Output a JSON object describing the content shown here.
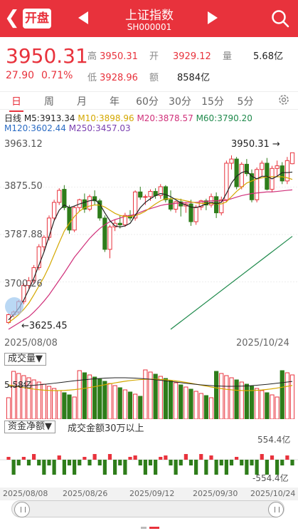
{
  "header": {
    "kaipan": "开盘",
    "title": "上证指数",
    "code": "SH000001"
  },
  "quote": {
    "price": "3950.31",
    "change": "27.90",
    "change_pct": "0.71%",
    "high_label": "高",
    "high": "3950.31",
    "open_label": "开",
    "open": "3929.12",
    "vol_label": "量",
    "vol": "5.68亿",
    "low_label": "低",
    "low": "3928.96",
    "amount_label": "额",
    "amount": "8584亿"
  },
  "tabs": [
    "日",
    "周",
    "月",
    "年",
    "60分",
    "30分",
    "15分",
    "5分"
  ],
  "ma": {
    "line1": [
      {
        "label": "日线 M5:3913.34",
        "color": "#222"
      },
      {
        "label": "M10:3898.96",
        "color": "#d4a800"
      },
      {
        "label": "M20:3878.57",
        "color": "#d0307a"
      },
      {
        "label": "M60:3790.20",
        "color": "#1f8a4c"
      }
    ],
    "line2": [
      {
        "label": "M120:3602.44",
        "color": "#2b6cc4"
      },
      {
        "label": "M250:3457.03",
        "color": "#7a3fb0"
      }
    ]
  },
  "axis": {
    "y_top": "3963.12",
    "y_mid": "3875.50",
    "y_low": "3787.88",
    "y_bot": "3700.26",
    "min_label": "3625.45",
    "max_label": "3950.31",
    "start_date": "2025/08/08",
    "end_date": "2025/10/24"
  },
  "volume": {
    "label": "成交量▼",
    "value": "5.58亿"
  },
  "fund": {
    "label": "资金净额▼",
    "note": "成交金额30万以上",
    "top": "554.4亿",
    "bottom": "-554.4亿"
  },
  "timeline": [
    "2025/08/08",
    "2025/08/26",
    "2025/09/12",
    "2025/09/30",
    "2025/10/24"
  ],
  "colors": {
    "up": "#e8323c",
    "down": "#2e7d1a"
  },
  "chart_data": {
    "type": "candlestick",
    "ylim": [
      3612,
      3975
    ],
    "candles": [
      [
        3625,
        3642,
        3622,
        3640
      ],
      [
        3640,
        3648,
        3635,
        3645
      ],
      [
        3645,
        3668,
        3640,
        3665
      ],
      [
        3665,
        3700,
        3660,
        3696
      ],
      [
        3696,
        3712,
        3690,
        3705
      ],
      [
        3705,
        3735,
        3700,
        3730
      ],
      [
        3730,
        3775,
        3725,
        3770
      ],
      [
        3770,
        3792,
        3760,
        3788
      ],
      [
        3788,
        3830,
        3782,
        3825
      ],
      [
        3825,
        3860,
        3820,
        3855
      ],
      [
        3855,
        3882,
        3850,
        3878
      ],
      [
        3880,
        3888,
        3840,
        3845
      ],
      [
        3845,
        3850,
        3795,
        3802
      ],
      [
        3802,
        3848,
        3798,
        3845
      ],
      [
        3845,
        3862,
        3838,
        3860
      ],
      [
        3860,
        3872,
        3835,
        3842
      ],
      [
        3842,
        3870,
        3838,
        3866
      ],
      [
        3866,
        3878,
        3850,
        3858
      ],
      [
        3858,
        3862,
        3820,
        3825
      ],
      [
        3825,
        3830,
        3760,
        3765
      ],
      [
        3765,
        3812,
        3748,
        3808
      ],
      [
        3808,
        3822,
        3800,
        3815
      ],
      [
        3815,
        3830,
        3805,
        3812
      ],
      [
        3812,
        3835,
        3808,
        3830
      ],
      [
        3830,
        3840,
        3820,
        3825
      ],
      [
        3825,
        3878,
        3820,
        3875
      ],
      [
        3875,
        3885,
        3860,
        3865
      ],
      [
        3865,
        3870,
        3850,
        3866
      ],
      [
        3866,
        3880,
        3858,
        3876
      ],
      [
        3876,
        3882,
        3862,
        3868
      ],
      [
        3868,
        3890,
        3862,
        3885
      ],
      [
        3885,
        3888,
        3855,
        3860
      ],
      [
        3860,
        3878,
        3838,
        3842
      ],
      [
        3842,
        3858,
        3835,
        3856
      ],
      [
        3856,
        3862,
        3828,
        3848
      ],
      [
        3848,
        3855,
        3835,
        3852
      ],
      [
        3852,
        3860,
        3810,
        3818
      ],
      [
        3818,
        3850,
        3812,
        3846
      ],
      [
        3846,
        3860,
        3840,
        3858
      ],
      [
        3858,
        3862,
        3840,
        3850
      ],
      [
        3850,
        3872,
        3845,
        3866
      ],
      [
        3866,
        3874,
        3825,
        3835
      ],
      [
        3835,
        3866,
        3830,
        3860
      ],
      [
        3860,
        3935,
        3855,
        3930
      ],
      [
        3930,
        3945,
        3918,
        3938
      ],
      [
        3938,
        3942,
        3880,
        3885
      ],
      [
        3885,
        3932,
        3880,
        3928
      ],
      [
        3928,
        3938,
        3905,
        3910
      ],
      [
        3910,
        3918,
        3855,
        3860
      ],
      [
        3860,
        3922,
        3855,
        3918
      ],
      [
        3918,
        3935,
        3905,
        3930
      ],
      [
        3930,
        3940,
        3878,
        3880
      ],
      [
        3880,
        3925,
        3875,
        3920
      ],
      [
        3920,
        3935,
        3905,
        3925
      ],
      [
        3925,
        3932,
        3890,
        3896
      ],
      [
        3896,
        3942,
        3890,
        3935
      ],
      [
        3929,
        3950,
        3928,
        3950
      ]
    ],
    "ma5": [
      3630,
      3640,
      3652,
      3668,
      3688,
      3710,
      3735,
      3760,
      3790,
      3820,
      3840,
      3850,
      3845,
      3848,
      3852,
      3855,
      3858,
      3860,
      3852,
      3835,
      3820,
      3810,
      3808,
      3810,
      3815,
      3830,
      3845,
      3855,
      3862,
      3868,
      3872,
      3870,
      3866,
      3860,
      3854,
      3850,
      3846,
      3845,
      3848,
      3852,
      3855,
      3852,
      3855,
      3872,
      3892,
      3905,
      3912,
      3915,
      3905,
      3900,
      3905,
      3905,
      3900,
      3905,
      3912,
      3912,
      3913
    ],
    "ma10": [
      3625,
      3632,
      3640,
      3650,
      3662,
      3678,
      3695,
      3712,
      3732,
      3755,
      3778,
      3800,
      3815,
      3828,
      3838,
      3845,
      3848,
      3850,
      3850,
      3846,
      3840,
      3834,
      3830,
      3828,
      3828,
      3830,
      3833,
      3838,
      3845,
      3852,
      3858,
      3862,
      3862,
      3862,
      3860,
      3858,
      3856,
      3854,
      3853,
      3853,
      3853,
      3852,
      3852,
      3856,
      3866,
      3876,
      3884,
      3892,
      3896,
      3900,
      3902,
      3904,
      3904,
      3904,
      3904,
      3902,
      3899
    ],
    "ma20": [
      3612,
      3618,
      3624,
      3630,
      3636,
      3645,
      3655,
      3666,
      3678,
      3692,
      3706,
      3720,
      3735,
      3750,
      3762,
      3774,
      3786,
      3796,
      3805,
      3812,
      3818,
      3822,
      3825,
      3828,
      3830,
      3832,
      3836,
      3840,
      3843,
      3846,
      3849,
      3851,
      3852,
      3853,
      3854,
      3855,
      3855,
      3855,
      3856,
      3857,
      3858,
      3858,
      3858,
      3859,
      3862,
      3865,
      3868,
      3870,
      3872,
      3873,
      3874,
      3875,
      3875,
      3876,
      3877,
      3878,
      3879
    ],
    "ma60_segment": [
      [
        32,
        3612
      ],
      [
        56,
        3790
      ]
    ]
  }
}
